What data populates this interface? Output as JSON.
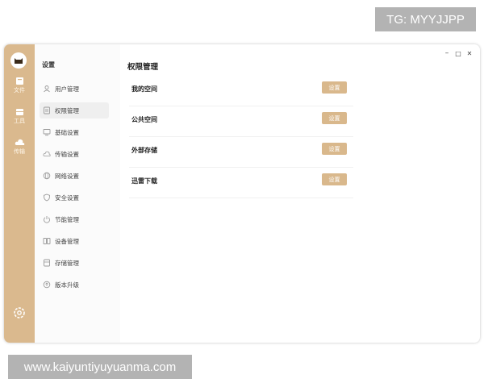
{
  "watermarks": {
    "top": "TG: MYYJJPP",
    "bottom": "www.kaiyuntiyuyuanma.com"
  },
  "window_controls": {
    "minimize": "–",
    "maximize": "□",
    "close": "✕"
  },
  "rail": {
    "items": [
      {
        "label": "文件",
        "icon": "folder-icon"
      },
      {
        "label": "工具",
        "icon": "toolbox-icon"
      },
      {
        "label": "传输",
        "icon": "cloud-icon"
      }
    ]
  },
  "subnav": {
    "title": "设置",
    "items": [
      {
        "label": "用户管理",
        "icon": "user-icon"
      },
      {
        "label": "权限管理",
        "icon": "permission-icon",
        "active": true
      },
      {
        "label": "基础设置",
        "icon": "monitor-icon"
      },
      {
        "label": "传输设置",
        "icon": "cloud-transfer-icon"
      },
      {
        "label": "网络设置",
        "icon": "globe-icon"
      },
      {
        "label": "安全设置",
        "icon": "shield-icon"
      },
      {
        "label": "节能管理",
        "icon": "power-icon"
      },
      {
        "label": "设备管理",
        "icon": "device-icon"
      },
      {
        "label": "存储管理",
        "icon": "storage-icon"
      },
      {
        "label": "版本升级",
        "icon": "upgrade-icon"
      }
    ]
  },
  "main": {
    "title": "权限管理",
    "rows": [
      {
        "name": "我的空间",
        "button": "设置"
      },
      {
        "name": "公共空间",
        "button": "设置"
      },
      {
        "name": "外部存储",
        "button": "设置"
      },
      {
        "name": "迅雷下载",
        "button": "设置"
      }
    ]
  },
  "colors": {
    "accent": "#dab98e",
    "button": "#d9b88c"
  }
}
